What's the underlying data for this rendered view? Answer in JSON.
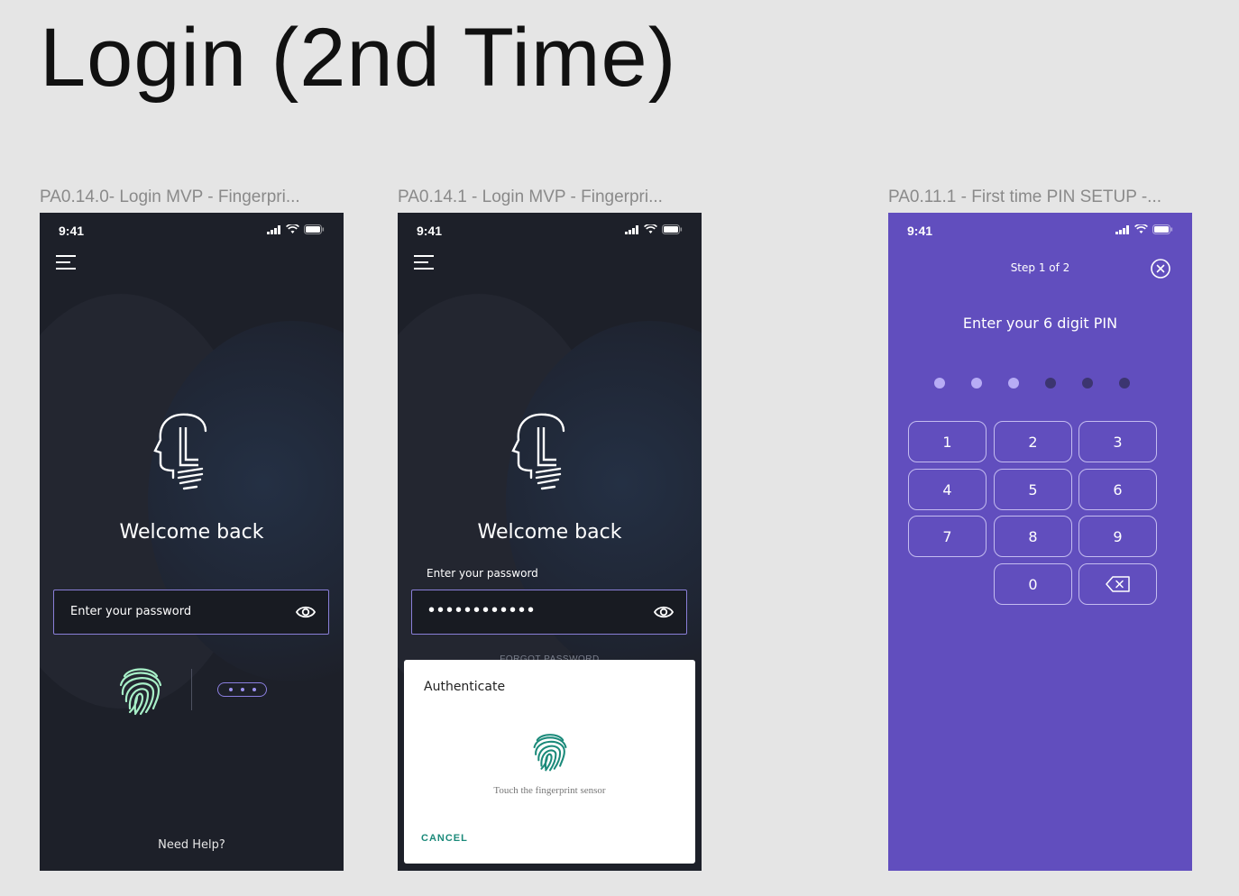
{
  "page": {
    "title": "Login (2nd Time)"
  },
  "frames": [
    {
      "label": "PA0.14.0- Login MVP - Fingerpri...",
      "status_time": "9:41",
      "welcome": "Welcome back",
      "password_placeholder": "Enter your password",
      "help_link": "Need Help?"
    },
    {
      "label": "PA0.14.1 - Login MVP - Fingerpri...",
      "status_time": "9:41",
      "welcome": "Welcome back",
      "password_caption": "Enter your password",
      "password_value": "••••••••••••",
      "forgot_link": "FORGOT PASSWORD",
      "dialog": {
        "title": "Authenticate",
        "hint": "Touch the fingerprint sensor",
        "cancel": "CANCEL"
      }
    },
    {
      "label": "PA0.11.1 - First time PIN SETUP -...",
      "status_time": "9:41",
      "step": "Step 1 of 2",
      "pin_title": "Enter your 6 digit PIN",
      "pin_filled": 3,
      "pin_length": 6,
      "keys": [
        "1",
        "2",
        "3",
        "4",
        "5",
        "6",
        "7",
        "8",
        "9",
        "0"
      ]
    }
  ],
  "colors": {
    "dark_bg": "#1d2029",
    "purple_bg": "#614ebe",
    "accent_green": "#a8f0c8",
    "dialog_teal": "#1b8a7a"
  },
  "icons": [
    "menu-icon",
    "logo-icon",
    "eye-icon",
    "fingerprint-icon",
    "close-icon",
    "backspace-icon",
    "signal-icon",
    "wifi-icon",
    "battery-icon"
  ]
}
